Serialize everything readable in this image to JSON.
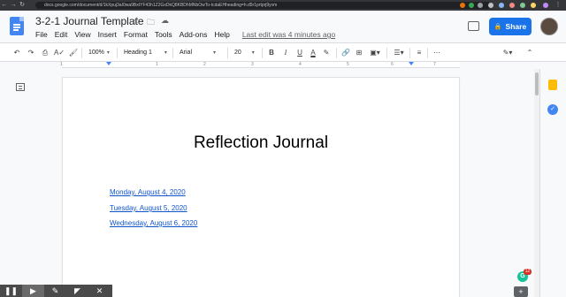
{
  "browser": {
    "url": "docs.google.com/document/d/1kXpuj3aI0wa9BxtYF43h1Z2GxDkQ8KBDhMNbOwTo-tcdaEHheading=h.d5r1prtprj9yvm"
  },
  "header": {
    "doc_title": "3-2-1 Journal Template",
    "menu": [
      "File",
      "Edit",
      "View",
      "Insert",
      "Format",
      "Tools",
      "Add-ons",
      "Help"
    ],
    "last_edit": "Last edit was 4 minutes ago",
    "share_label": "Share"
  },
  "toolbar": {
    "zoom": "100%",
    "style": "Heading 1",
    "font": "Arial",
    "font_size": "20"
  },
  "ruler": {
    "numbers": [
      "1",
      "1",
      "2",
      "3",
      "4",
      "5",
      "6",
      "7"
    ]
  },
  "document": {
    "heading": "Reflection Journal",
    "links": [
      "Monday, August 4, 2020",
      "Tuesday, August 5, 2020",
      "Wednesday, August 6, 2020"
    ]
  },
  "grammarly": {
    "badge_count": "12",
    "letter": "G"
  },
  "colors": {
    "accent": "#1a73e8",
    "link": "#1155cc",
    "docs_blue": "#4285f4"
  }
}
